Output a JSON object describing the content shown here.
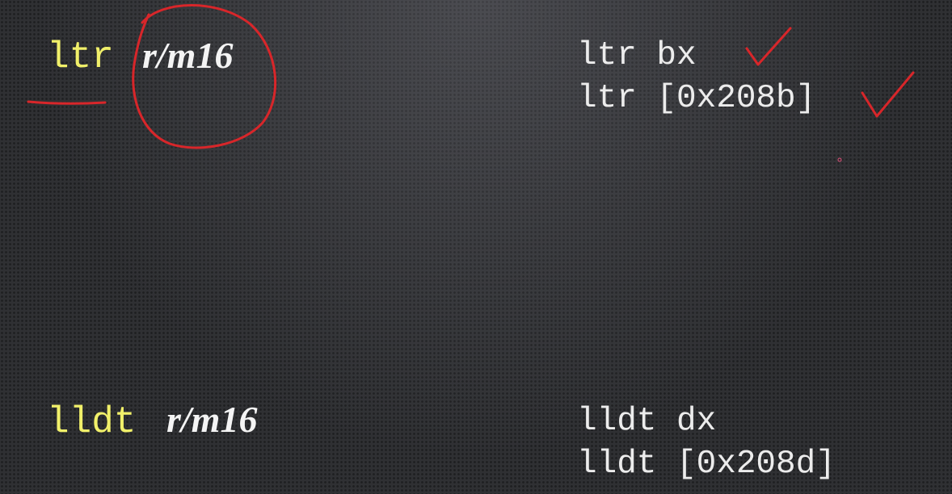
{
  "slide": {
    "instructions": [
      {
        "mnemonic": "ltr",
        "operand": "r/m16",
        "examples": [
          "ltr bx",
          "ltr [0x208b]"
        ]
      },
      {
        "mnemonic": "lldt",
        "operand": "r/m16",
        "examples": [
          "lldt dx",
          "lldt [0x208d]"
        ]
      }
    ]
  },
  "annotations": {
    "ink_color": "#d8262a",
    "marks": [
      "underline-mnemonic",
      "circle-operand",
      "checkmark-example-1",
      "checkmark-example-2"
    ]
  },
  "colors": {
    "mnemonic": "#f1f06a",
    "text": "#ececec",
    "background": "#2f3033"
  }
}
